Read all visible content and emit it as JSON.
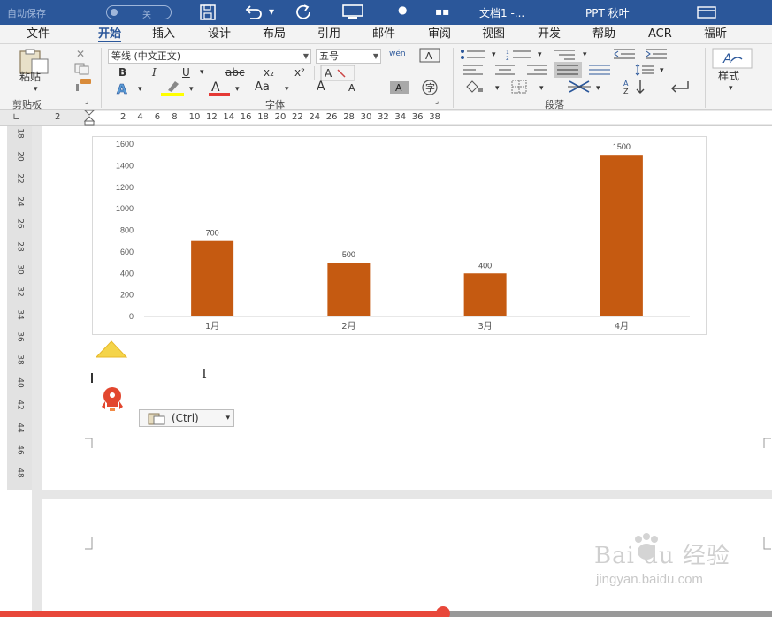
{
  "titlebar": {
    "autosave_label": "自动保存",
    "autosave_state": "关",
    "doc_title": "文档1 -...",
    "user_name": "PPT 秋叶"
  },
  "tabs": [
    "文件",
    "开始",
    "插入",
    "设计",
    "布局",
    "引用",
    "邮件",
    "审阅",
    "视图",
    "开发",
    "帮助",
    "ACR",
    "福昕"
  ],
  "active_tab": "开始",
  "ribbon": {
    "paste_label": "粘贴",
    "font_name": "等线 (中文正文)",
    "font_size": "五号",
    "bold": "B",
    "italic": "I",
    "underline": "U",
    "strike": "abc",
    "subscript": "x₂",
    "superscript": "x²",
    "font_color_letter": "A",
    "case_label": "Aa",
    "grow_font": "A",
    "shrink_font": "A",
    "phonetic": "wén",
    "styles_label": "样式",
    "groups": [
      "剪贴板",
      "字体",
      "段落"
    ]
  },
  "ruler": {
    "h_left": "2",
    "h_numbers": [
      "2",
      "4",
      "6",
      "8",
      "10",
      "12",
      "14",
      "16",
      "18",
      "20",
      "22",
      "24",
      "26",
      "28",
      "30",
      "32",
      "34",
      "36",
      "38"
    ],
    "v_numbers": [
      "18",
      "20",
      "22",
      "24",
      "26",
      "28",
      "30",
      "32",
      "34",
      "36",
      "38",
      "40",
      "42",
      "44",
      "46",
      "48"
    ]
  },
  "chart_data": {
    "type": "bar",
    "categories": [
      "1月",
      "2月",
      "3月",
      "4月"
    ],
    "values": [
      700,
      500,
      400,
      1500
    ],
    "data_labels": [
      "700",
      "500",
      "400",
      "1500"
    ],
    "yticks": [
      "0",
      "200",
      "400",
      "600",
      "800",
      "1000",
      "1200",
      "1400",
      "1600"
    ],
    "ylim": [
      0,
      1600
    ],
    "bar_color": "#c55a11",
    "grid": false
  },
  "paste_options_label": "(Ctrl)",
  "watermark": {
    "brand": "Bai du 经验",
    "url": "jingyan.baidu.com"
  },
  "colors": {
    "titlebar": "#2b579a",
    "ribbon": "#f3f3f3",
    "accent": "#2b579a",
    "highlight": "#ffff00",
    "font_red": "#e53935",
    "progress": "#e8473a"
  }
}
